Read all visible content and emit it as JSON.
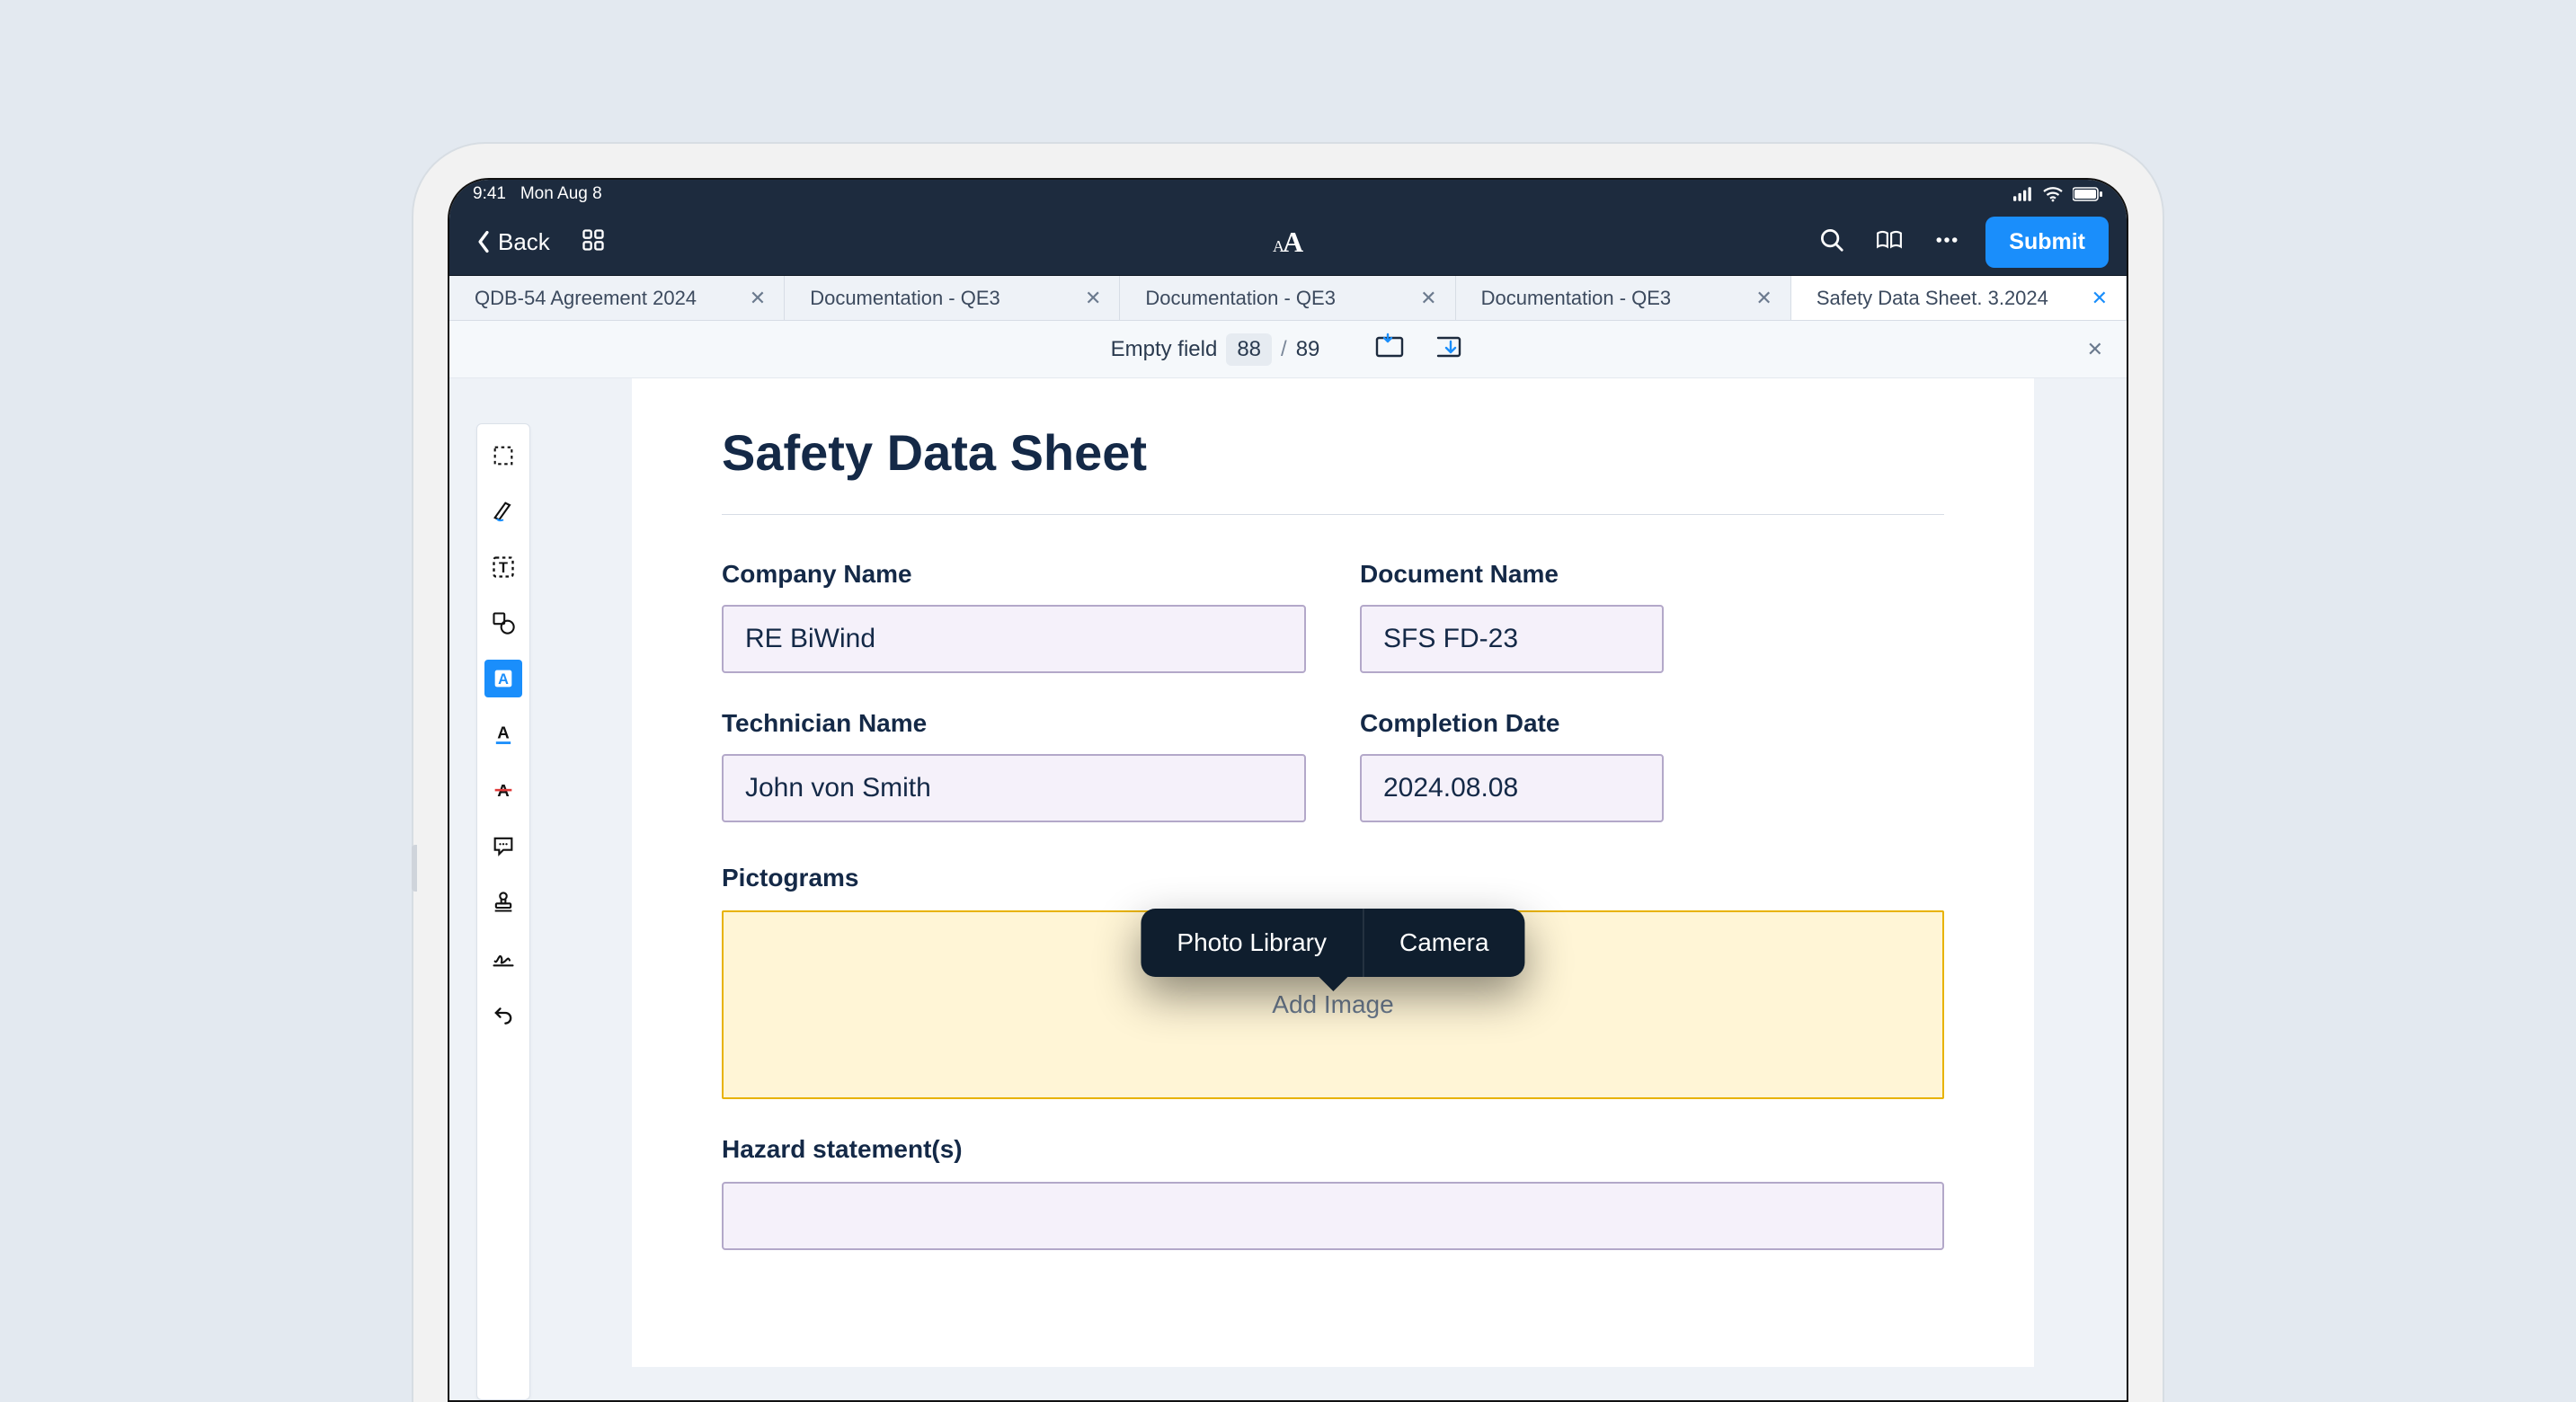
{
  "statusbar": {
    "time": "9:41",
    "date": "Mon Aug 8"
  },
  "topnav": {
    "back_label": "Back",
    "submit_label": "Submit"
  },
  "tabs": [
    {
      "label": "QDB-54 Agreement 2024",
      "active": false
    },
    {
      "label": "Documentation - QE3",
      "active": false
    },
    {
      "label": "Documentation - QE3",
      "active": false
    },
    {
      "label": "Documentation - QE3",
      "active": false
    },
    {
      "label": "Safety Data Sheet. 3.2024",
      "active": true
    }
  ],
  "fieldnav": {
    "label": "Empty field",
    "current": "88",
    "total": "89"
  },
  "document": {
    "title": "Safety Data Sheet",
    "fields": {
      "company_name": {
        "label": "Company Name",
        "value": "RE BiWind"
      },
      "document_name": {
        "label": "Document Name",
        "value": "SFS FD-23"
      },
      "technician_name": {
        "label": "Technician Name",
        "value": "John von Smith"
      },
      "completion_date": {
        "label": "Completion Date",
        "value": "2024.08.08"
      }
    },
    "pictograms": {
      "label": "Pictograms",
      "placeholder": "Add Image"
    },
    "hazard": {
      "label": "Hazard statement(s)"
    }
  },
  "popover": {
    "photo_library": "Photo Library",
    "camera": "Camera"
  },
  "tools": [
    "select",
    "highlighter",
    "text",
    "shape",
    "fill",
    "underline",
    "strikethrough",
    "comment",
    "stamp",
    "signature",
    "undo"
  ]
}
